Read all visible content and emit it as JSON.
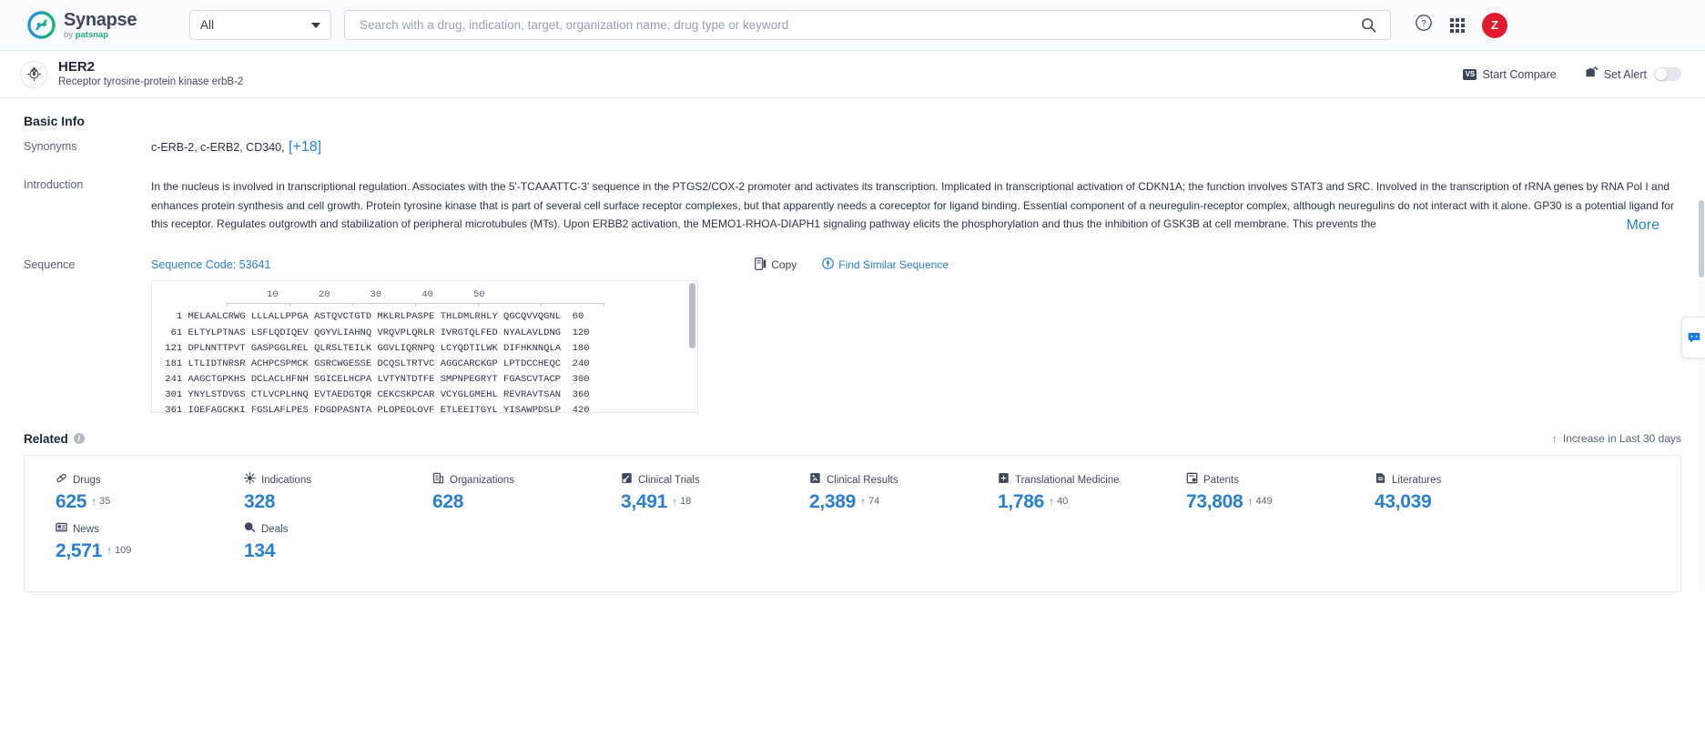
{
  "topbar": {
    "brand_name": "Synapse",
    "brand_sub_prefix": "by ",
    "brand_sub_name": "patsnap",
    "scope_value": "All",
    "search_placeholder": "Search with a drug, indication, target, organization name, drug type or keyword",
    "search_value": "",
    "avatar_initial": "Z"
  },
  "pagehead": {
    "title": "HER2",
    "subtitle": "Receptor tyrosine-protein kinase erbB-2",
    "start_compare": "Start Compare",
    "vs_badge": "VS",
    "set_alert": "Set Alert",
    "alert_enabled": false
  },
  "basic_info": {
    "section_title": "Basic Info",
    "synonyms_label": "Synonyms",
    "synonyms_value": "c-ERB-2,  c-ERB2,  CD340,",
    "synonyms_more": "[+18]",
    "introduction_label": "Introduction",
    "introduction_text": "In the nucleus is involved in transcriptional regulation. Associates with the 5'-TCAAATTC-3' sequence in the PTGS2/COX-2 promoter and activates its transcription. Implicated in transcriptional activation of CDKN1A; the function involves STAT3 and SRC. Involved in the transcription of rRNA genes by RNA Pol I and enhances protein synthesis and cell growth. Protein tyrosine kinase that is part of several cell surface receptor complexes, but that apparently needs a coreceptor for ligand binding. Essential component of a neuregulin-receptor complex, although neuregulins do not interact with it alone. GP30 is a potential ligand for this receptor. Regulates outgrowth and stabilization of peripheral microtubules (MTs). Upon ERBB2 activation, the MEMO1-RHOA-DIAPH1 signaling pathway elicits the phosphorylation and thus the inhibition of GSK3B at cell membrane. This prevents the",
    "introduction_more": "More"
  },
  "sequence": {
    "label": "Sequence",
    "code_label": "Sequence Code: 53641",
    "copy_label": "Copy",
    "find_similar_label": "Find Similar Sequence",
    "ruler_ticks": [
      "10",
      "20",
      "30",
      "40",
      "50"
    ],
    "lines": [
      {
        "start": "1",
        "blocks": "MELAALCRWG LLLALLPPGA ASTQVCTGTD MKLRLPASPE THLDMLRHLY QGCQVVQGNL",
        "end": "60"
      },
      {
        "start": "61",
        "blocks": "ELTYLPTNAS LSFLQDIQEV QGYVLIAHNQ VRQVPLQRLR IVRGTQLFED NYALAVLDNG",
        "end": "120"
      },
      {
        "start": "121",
        "blocks": "DPLNNTTPVT GASPGGLREL QLRSLTEILK GGVLIQRNPQ LCYQDTILWK DIFHKNNQLA",
        "end": "180"
      },
      {
        "start": "181",
        "blocks": "LTLIDTNRSR ACHPCSPMCK GSRCWGESSE DCQSLTRTVC AGGCARCKGP LPTDCCHEQC",
        "end": "240"
      },
      {
        "start": "241",
        "blocks": "AAGCTGPKHS DCLACLHFNH SGICELHCPA LVTYNTDTFE SMPNPEGRYT FGASCVTACP",
        "end": "300"
      },
      {
        "start": "301",
        "blocks": "YNYLSTDVGS CTLVCPLHNQ EVTAEDGTQR CEKCSKPCAR VCYGLGMEHL REVRAVTSAN",
        "end": "360"
      },
      {
        "start": "361",
        "blocks": "IQEFAGCKKI FGSLAFLPES FDGDPASNTA PLQPEQLQVF ETLEEITGYL YISAWPDSLP",
        "end": "420"
      }
    ]
  },
  "related": {
    "title": "Related",
    "legend": "Increase in Last 30 days",
    "stats": [
      {
        "icon": "capsule-icon",
        "label": "Drugs",
        "value": "625",
        "delta": "35"
      },
      {
        "icon": "virus-icon",
        "label": "Indications",
        "value": "328",
        "delta": ""
      },
      {
        "icon": "building-icon",
        "label": "Organizations",
        "value": "628",
        "delta": ""
      },
      {
        "icon": "clinical-trial-icon",
        "label": "Clinical Trials",
        "value": "3,491",
        "delta": "18"
      },
      {
        "icon": "clinical-result-icon",
        "label": "Clinical Results",
        "value": "2,389",
        "delta": "74"
      },
      {
        "icon": "translational-medicine-icon",
        "label": "Translational Medicine",
        "value": "1,786",
        "delta": "40"
      },
      {
        "icon": "patent-icon",
        "label": "Patents",
        "value": "73,808",
        "delta": "449"
      },
      {
        "icon": "literature-icon",
        "label": "Literatures",
        "value": "43,039",
        "delta": ""
      },
      {
        "icon": "news-icon",
        "label": "News",
        "value": "2,571",
        "delta": "109"
      },
      {
        "icon": "deal-icon",
        "label": "Deals",
        "value": "134",
        "delta": ""
      }
    ]
  },
  "colors": {
    "accent_blue": "#2a7fd4",
    "brand_green": "#1bb07d",
    "increase_green": "#2aa84a",
    "avatar_red": "#e01b2c"
  }
}
